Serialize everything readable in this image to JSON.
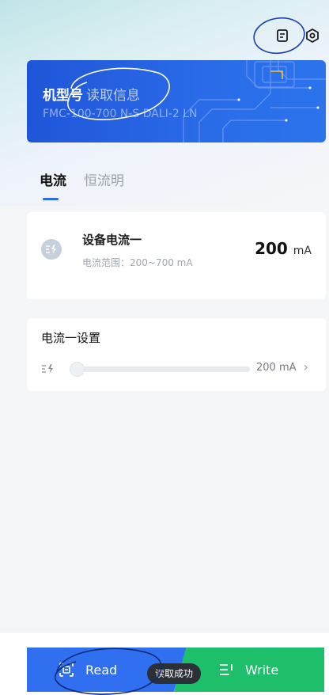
{
  "header": {
    "icons": [
      "document-icon",
      "settings-icon"
    ]
  },
  "banner": {
    "title": "机型号",
    "action": "读取信息",
    "model": "FMC-100-700 N-S DALI-2 LN"
  },
  "tabs": [
    {
      "label": "电流",
      "active": true
    },
    {
      "label": "恒流明",
      "active": false
    }
  ],
  "device": {
    "name": "设备电流一",
    "range": "电流范围：200~700 mA",
    "value": "200",
    "unit": "mA"
  },
  "setting": {
    "title": "电流一设置",
    "value": "200 mA",
    "level": 0
  },
  "actions": {
    "read_label": "Read",
    "write_label": "Write",
    "toast": "读取成功"
  },
  "colors": {
    "accent_blue": "#2f6ff0",
    "accent_green": "#1dbf6a"
  }
}
